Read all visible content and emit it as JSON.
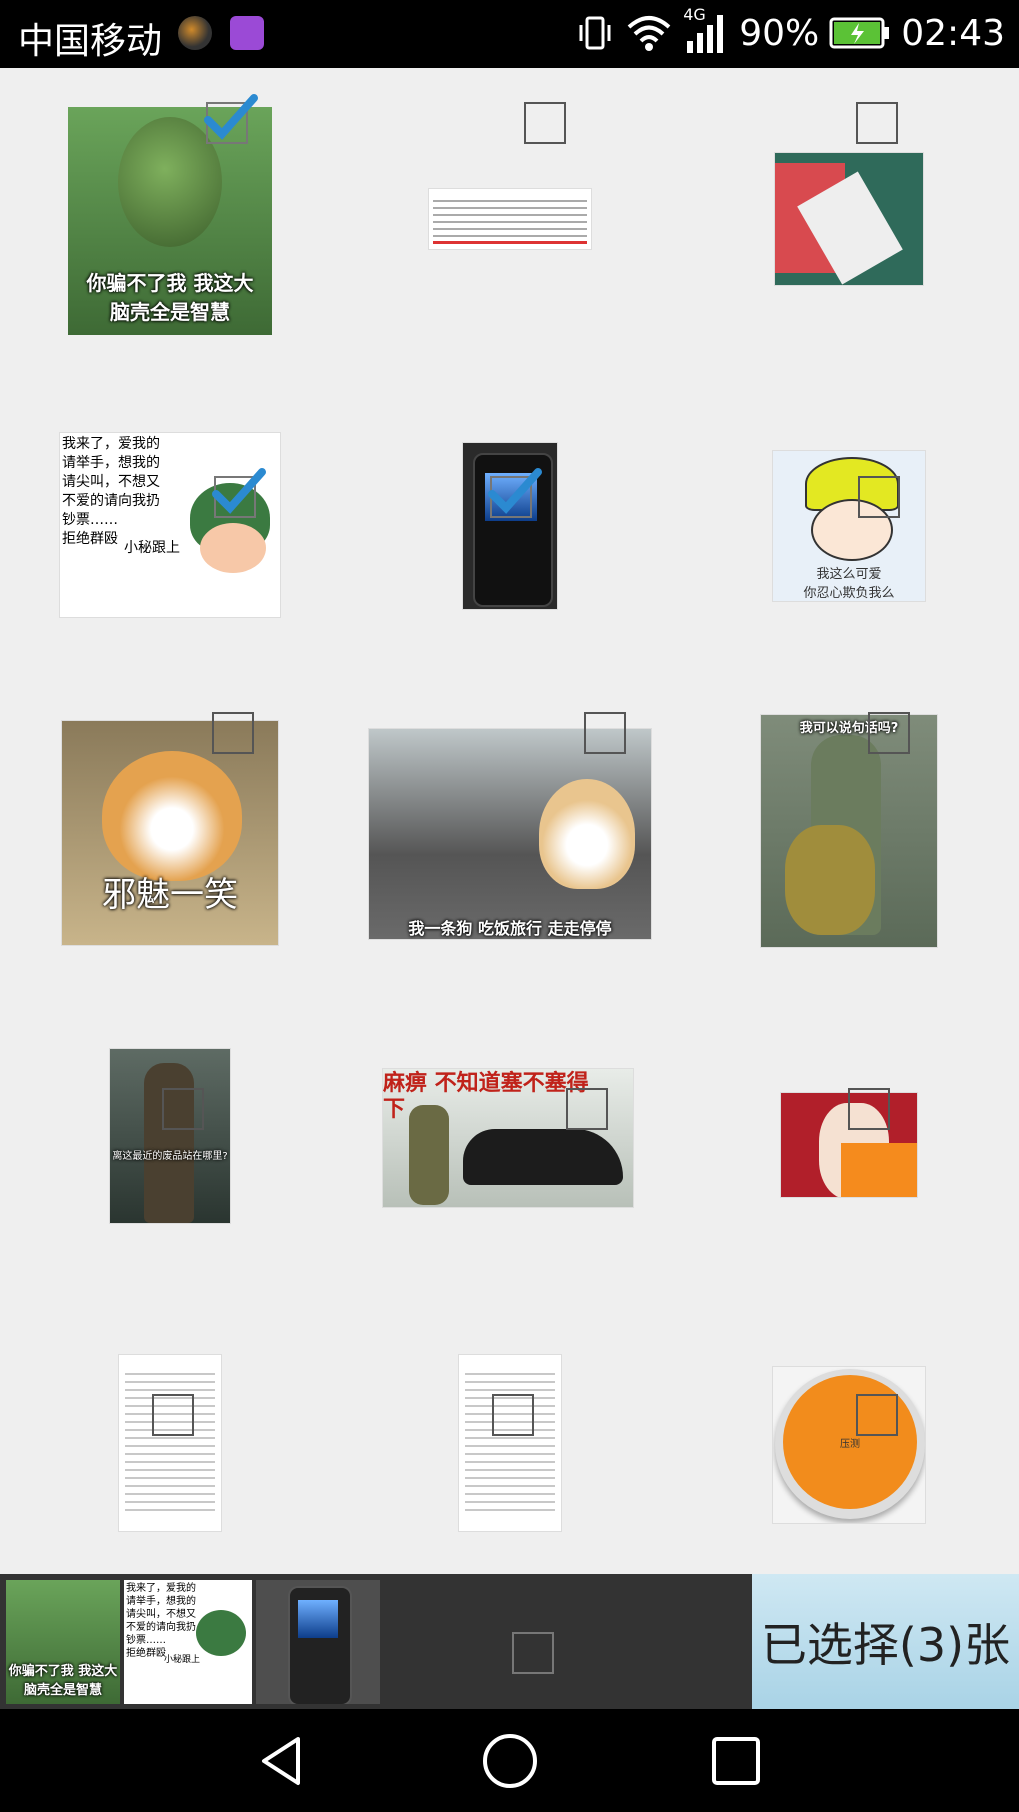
{
  "status_bar": {
    "carrier": "中国移动",
    "network": "4G",
    "battery": "90%",
    "time": "02:43"
  },
  "grid": {
    "items": [
      {
        "id": "img-1",
        "caption": "你骗不了我 我这大\n脑壳全是智慧",
        "checked": true
      },
      {
        "id": "img-2",
        "caption": "",
        "checked": false
      },
      {
        "id": "img-3",
        "caption": "",
        "checked": false
      },
      {
        "id": "img-4",
        "caption": "我来了，爱我的\n请举手，想我的\n请尖叫，不想又\n不爱的请向我扔\n钞票……\n拒绝群殴",
        "extra": "小秘跟上",
        "checked": true
      },
      {
        "id": "img-5",
        "caption": "",
        "checked": true
      },
      {
        "id": "img-6",
        "caption": "我这么可爱\n你忍心欺负我么",
        "checked": false
      },
      {
        "id": "img-7",
        "caption": "邪魅一笑",
        "checked": false
      },
      {
        "id": "img-8",
        "caption": "我一条狗 吃饭旅行 走走停停",
        "checked": false
      },
      {
        "id": "img-9",
        "caption": "我可以说句话吗?",
        "checked": false
      },
      {
        "id": "img-10",
        "caption": "离这最近的废品站在哪里?",
        "checked": false
      },
      {
        "id": "img-11",
        "caption": "麻痹 不知道塞不塞得\n下",
        "checked": false
      },
      {
        "id": "img-12",
        "caption": "",
        "checked": false
      },
      {
        "id": "img-13",
        "caption": "",
        "checked": false
      },
      {
        "id": "img-14",
        "caption": "",
        "checked": false
      },
      {
        "id": "img-15",
        "caption": "压测",
        "checked": false
      }
    ]
  },
  "preview": {
    "items": [
      {
        "caption": "你骗不了我 我这大\n脑壳全是智慧"
      },
      {
        "caption": "我来了，爱我的\n请举手，想我的\n请尖叫，不想又\n不爱的请向我扔\n钞票……\n拒绝群殴",
        "extra": "小秘跟上"
      },
      {
        "caption": ""
      }
    ]
  },
  "counter": {
    "label": "已选择(3)张"
  },
  "colors": {
    "tick": "#2b8ad1",
    "orange": "#f28c1c"
  },
  "icons": {
    "back": "back-icon",
    "home": "home-icon",
    "recents": "recents-icon"
  }
}
